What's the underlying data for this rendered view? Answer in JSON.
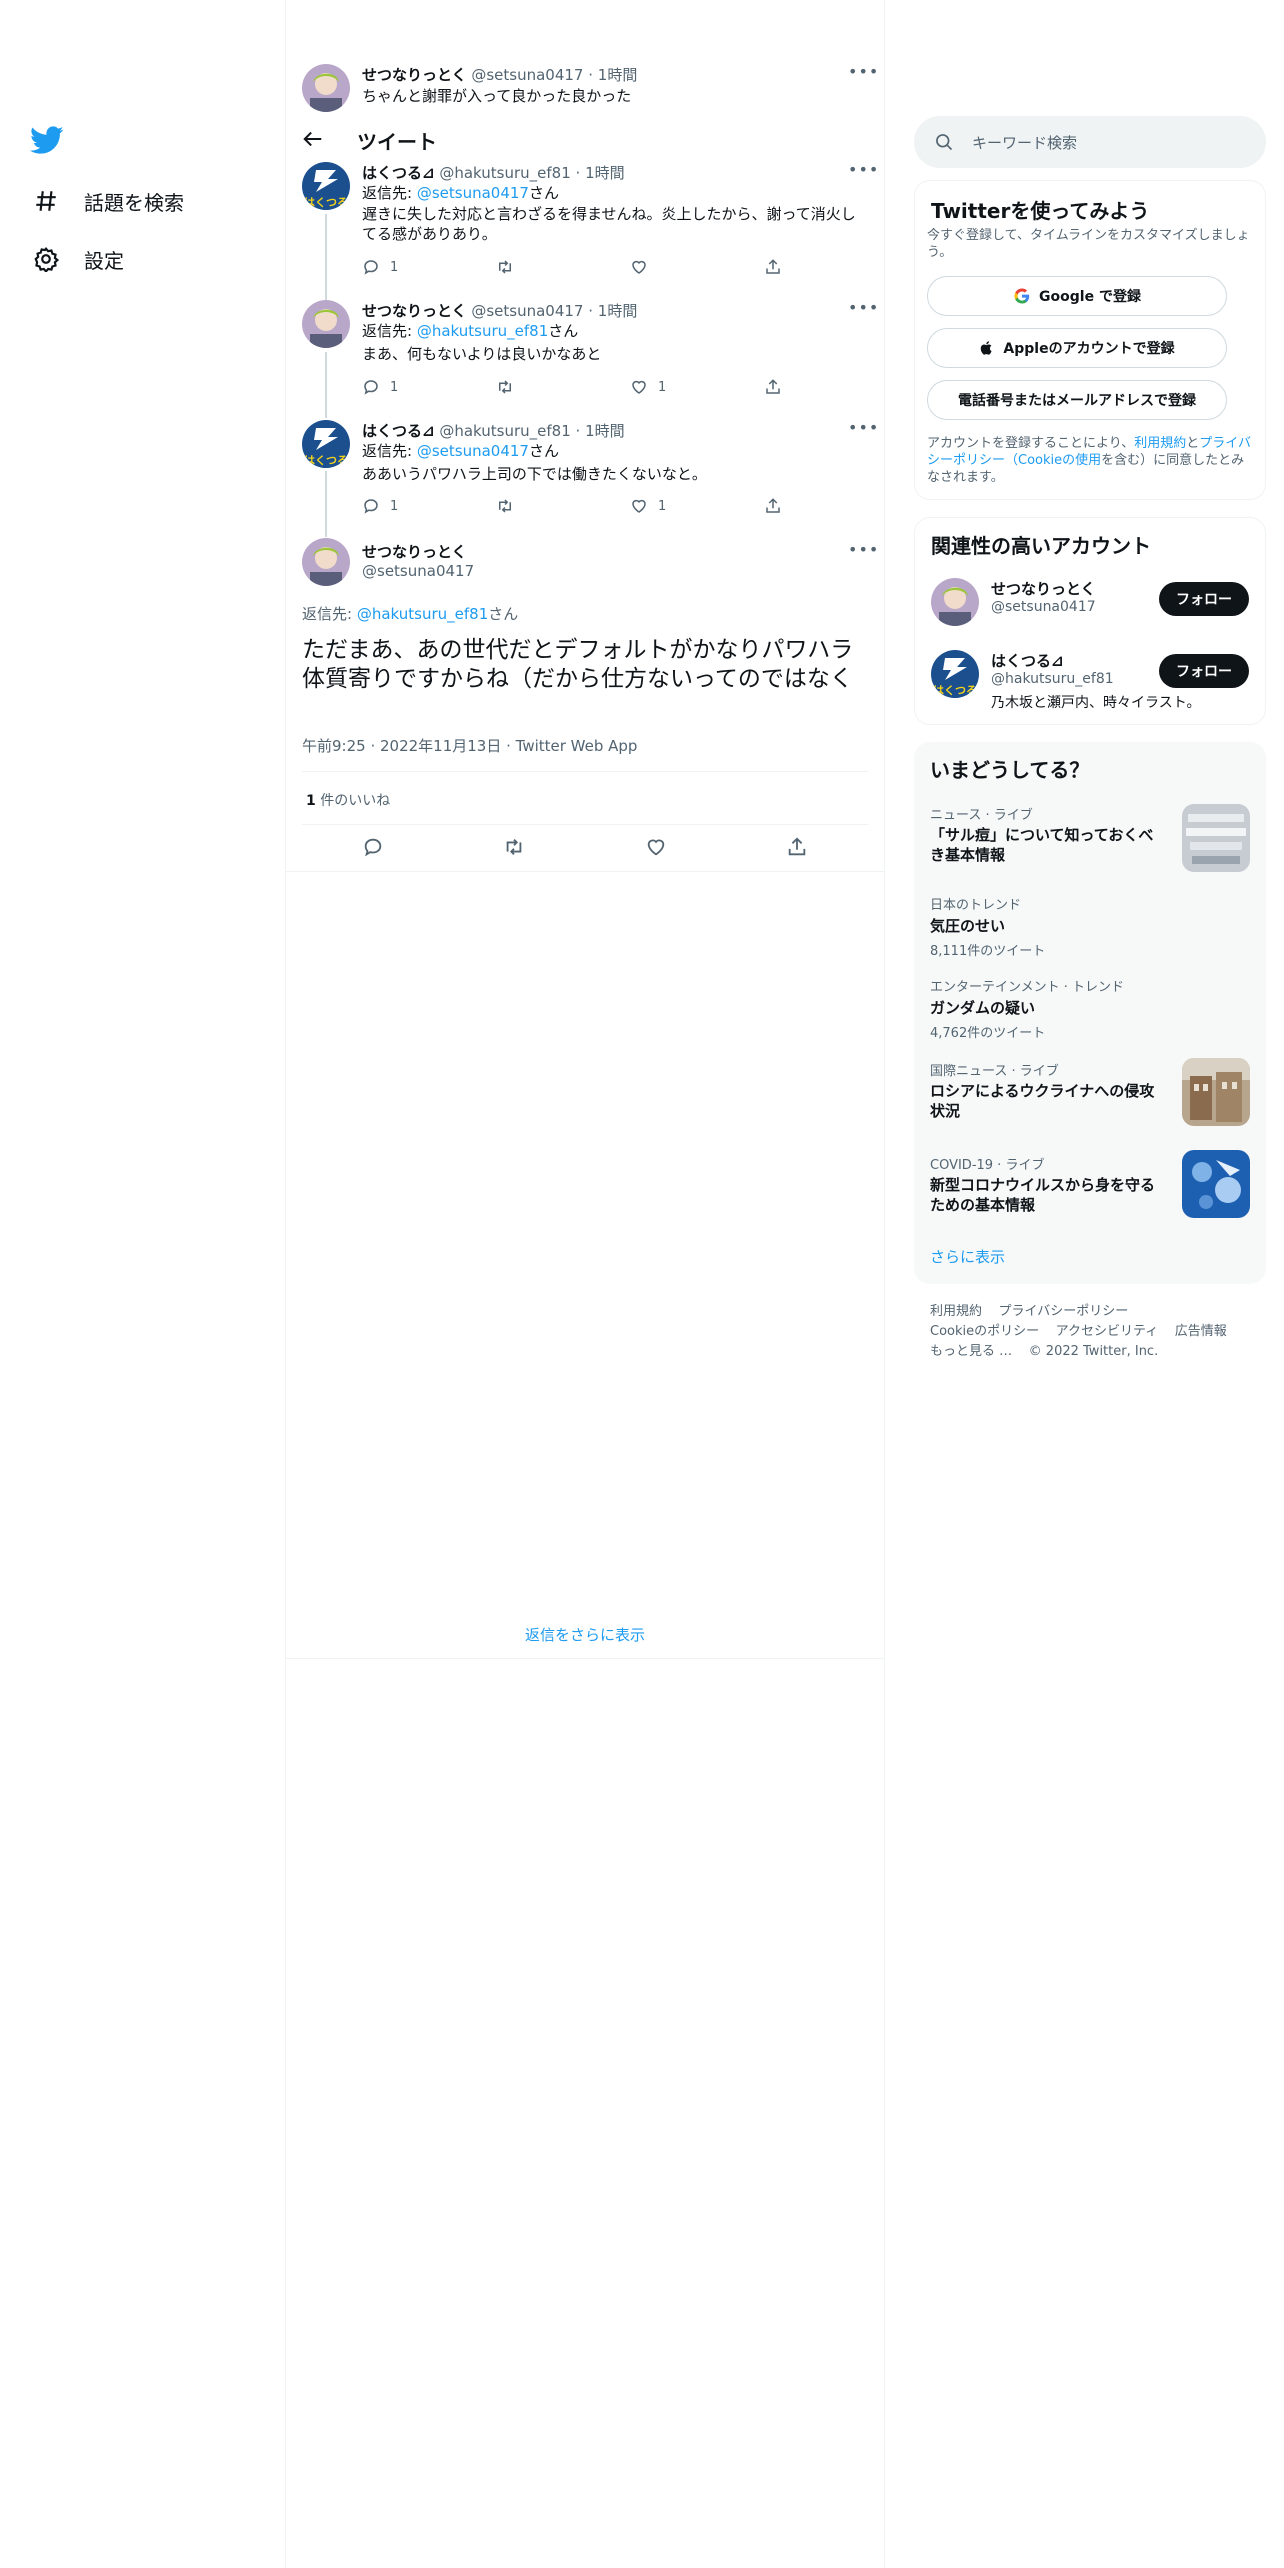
{
  "nav": {
    "items": [
      {
        "label": "話題を検索",
        "icon": "hashtag-icon"
      },
      {
        "label": "設定",
        "icon": "gear-icon"
      }
    ]
  },
  "header": {
    "title": "ツイート"
  },
  "top_tweet": {
    "name": "せつなりっとく",
    "handle": "@setsuna0417",
    "time": "· 1時間",
    "text": "ちゃんと謝罪が入って良かった良かった"
  },
  "thread": [
    {
      "name": "はくつる⊿",
      "handle": "@hakutsuru_ef81",
      "time": "· 1時間",
      "reply_prefix": "返信先: ",
      "reply_to": "",
      "reply_suffix": "",
      "reply_line": "返信先: @setsuna0417さん",
      "reply_user": "@setsuna0417",
      "text": "遅きに失した対応と言わざるを得ませんね。炎上したから、謝って消火してる感がありあり。",
      "replies": "1",
      "likes": ""
    },
    {
      "name": "せつなりっとく",
      "handle": "@setsuna0417",
      "time": "· 1時間",
      "reply_user": "@hakutsuru_ef81",
      "text": "まあ、何もないよりは良いかなあと",
      "replies": "1",
      "likes": "1"
    },
    {
      "name": "はくつる⊿",
      "handle": "@hakutsuru_ef81",
      "time": "· 1時間",
      "reply_user": "@setsuna0417",
      "text": "ああいうパワハラ上司の下では働きたくないなと。",
      "replies": "1",
      "likes": "1"
    }
  ],
  "reply_prefix": "返信先: ",
  "reply_suffix": "さん",
  "main_tweet": {
    "name": "せつなりっとく",
    "handle": "@setsuna0417",
    "reply_user": "@hakutsuru_ef81",
    "text": "ただまあ、あの世代だとデフォルトがかなりパワハラ体質寄りですからね（だから仕方ないってのではなく",
    "meta": "午前9:25 · 2022年11月13日 · Twitter Web App",
    "likes_count": "1",
    "likes_label": "件のいいね"
  },
  "show_more_replies": "返信をさらに表示",
  "search": {
    "placeholder": "キーワード検索"
  },
  "signup": {
    "title": "Twitterを使ってみよう",
    "subtitle": "今すぐ登録して、タイムラインをカスタマイズしましょう。",
    "google": "Google で登録",
    "apple": "Appleのアカウントで登録",
    "phone": "電話番号またはメールアドレスで登録",
    "legal_1": "アカウントを登録することにより、",
    "legal_link1": "利用規約",
    "legal_2": "と",
    "legal_link2": "プライバシーポリシー（Cookieの使用",
    "legal_3": "を含む）に同意したとみなされます。"
  },
  "related": {
    "title": "関連性の高いアカウント",
    "follow_label": "フォロー",
    "accounts": [
      {
        "name": "せつなりっとく",
        "handle": "@setsuna0417",
        "bio": ""
      },
      {
        "name": "はくつる⊿",
        "handle": "@hakutsuru_ef81",
        "bio": "乃木坂と瀬戸内、時々イラスト。"
      }
    ]
  },
  "trends": {
    "title": "いまどうしてる？",
    "items": [
      {
        "category": "ニュース · ライブ",
        "title": "「サル痘」について知っておくべき基本情報",
        "count": ""
      },
      {
        "category": "日本のトレンド",
        "title": "気圧のせい",
        "count": "8,111件のツイート"
      },
      {
        "category": "エンターテインメント · トレンド",
        "title": "ガンダムの疑い",
        "count": "4,762件のツイート"
      },
      {
        "category": "国際ニュース · ライブ",
        "title": "ロシアによるウクライナへの侵攻状況",
        "count": ""
      },
      {
        "category": "COVID-19 · ライブ",
        "title": "新型コロナウイルスから身を守るための基本情報",
        "count": ""
      }
    ],
    "show_more": "さらに表示"
  },
  "footer": {
    "links_row1": [
      "利用規約",
      "プライバシーポリシー"
    ],
    "links_row2": [
      "Cookieのポリシー",
      "アクセシビリティ",
      "広告情報"
    ],
    "more": "もっと見る …",
    "copyright": "© 2022 Twitter, Inc."
  },
  "colors": {
    "accent": "#1d9bf0",
    "text": "#0f1419",
    "muted": "#536471"
  }
}
